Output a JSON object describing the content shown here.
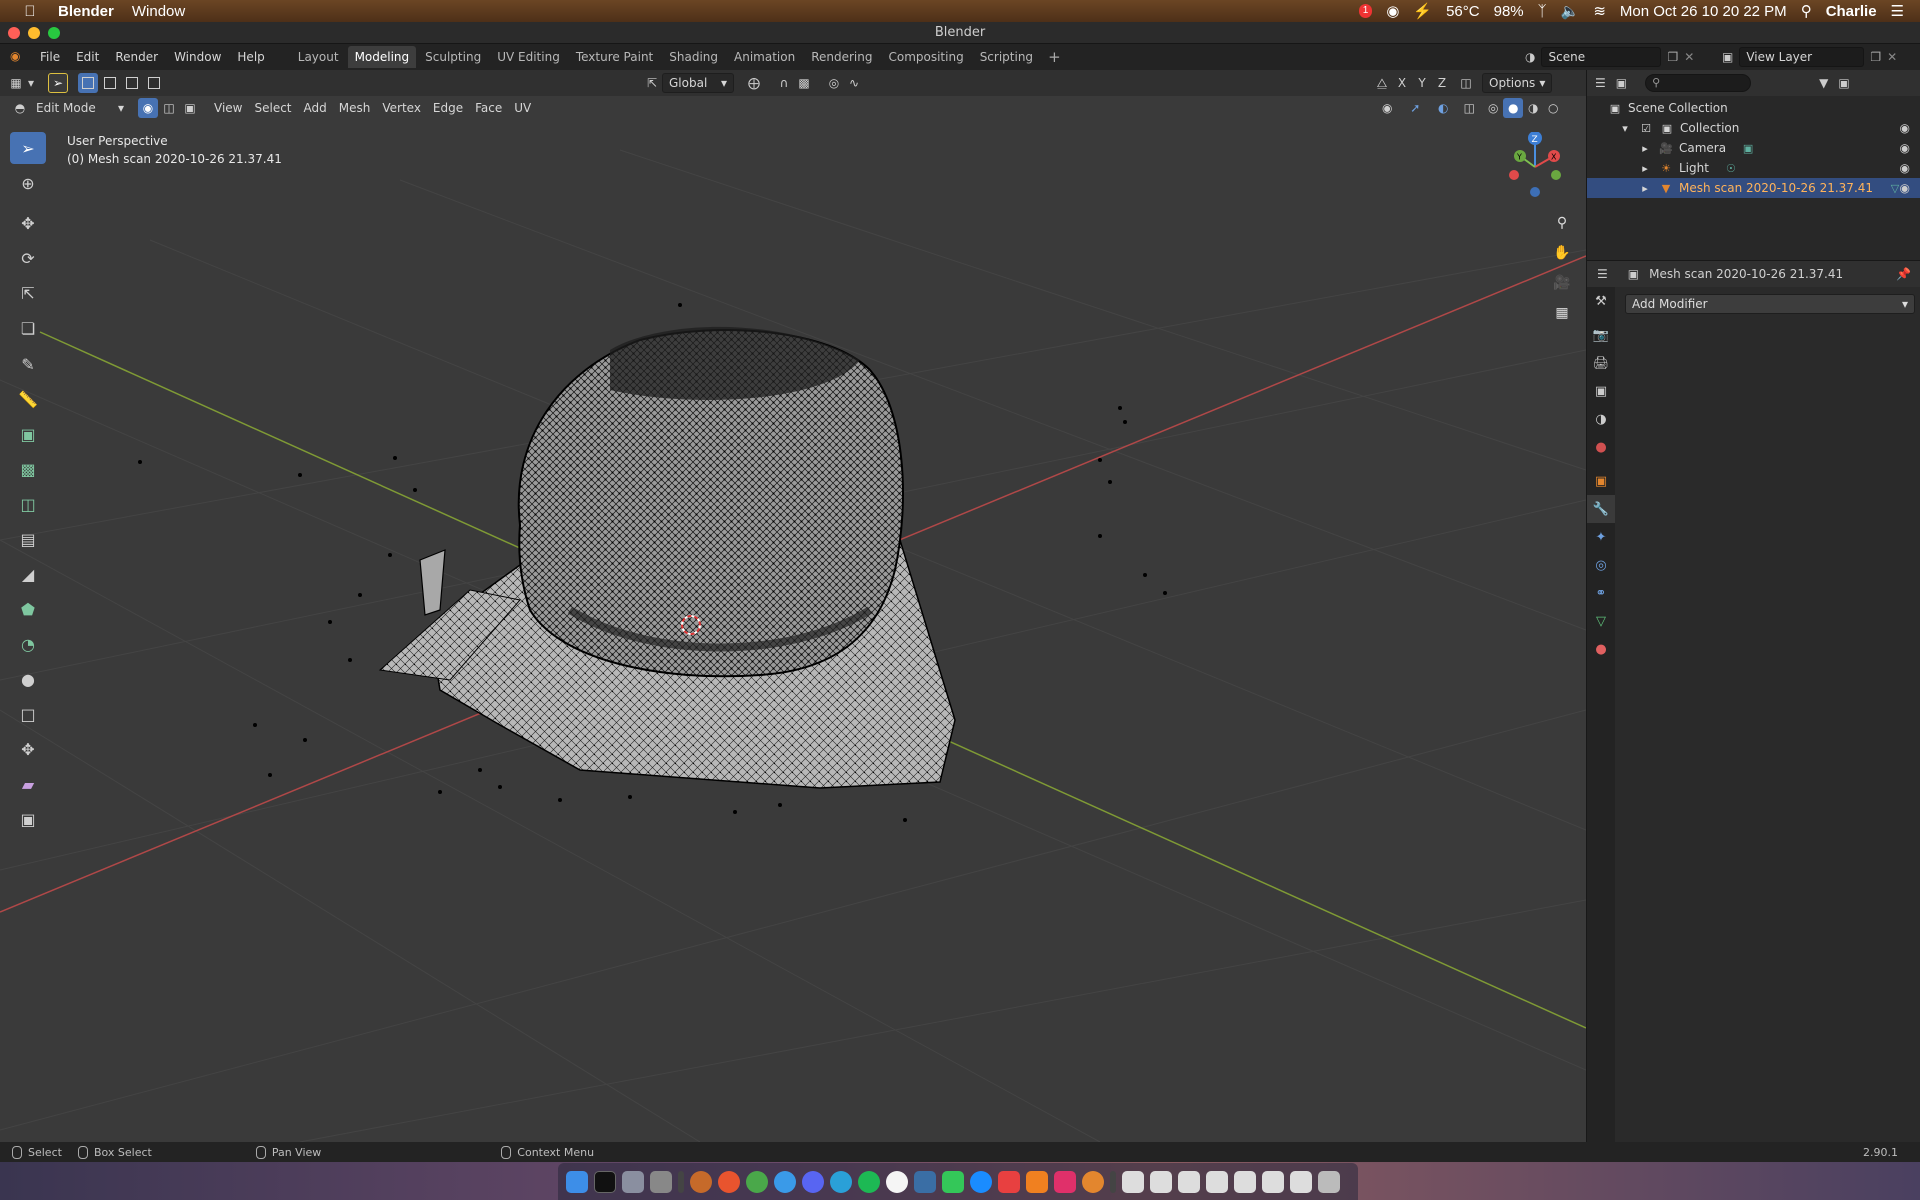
{
  "macos": {
    "app_name": "Blender",
    "menu_window": "Window",
    "notif_count": "1",
    "temp": "56°C",
    "battery": "98%",
    "datetime": "Mon Oct 26  10 20 22 PM",
    "user": "Charlie"
  },
  "window_title": "Blender",
  "menu": {
    "items": [
      "File",
      "Edit",
      "Render",
      "Window",
      "Help"
    ]
  },
  "workspaces": [
    "Layout",
    "Modeling",
    "Sculpting",
    "UV Editing",
    "Texture Paint",
    "Shading",
    "Animation",
    "Rendering",
    "Compositing",
    "Scripting"
  ],
  "active_workspace": "Modeling",
  "scene_name": "Scene",
  "view_layer": "View Layer",
  "viewport": {
    "transform_orientation": "Global",
    "options_label": "Options",
    "axis_x": "X",
    "axis_y": "Y",
    "axis_z": "Z",
    "mode": "Edit Mode",
    "header_menus": [
      "View",
      "Select",
      "Add",
      "Mesh",
      "Vertex",
      "Edge",
      "Face",
      "UV"
    ],
    "info_line1": "User Perspective",
    "info_line2": "(0) Mesh scan 2020-10-26 21.37.41"
  },
  "outliner": {
    "scene_collection": "Scene Collection",
    "collection": "Collection",
    "camera": "Camera",
    "light": "Light",
    "mesh": "Mesh scan 2020-10-26 21.37.41"
  },
  "properties": {
    "object_name": "Mesh scan 2020-10-26 21.37.41",
    "add_modifier": "Add Modifier"
  },
  "statusbar": {
    "select": "Select",
    "box_select": "Box Select",
    "pan_view": "Pan View",
    "context_menu": "Context Menu",
    "version": "2.90.1"
  },
  "colors": {
    "accent_blue": "#4772b3",
    "selected_row": "#334d80",
    "axis_x_red": "#c04a4a",
    "axis_y_green": "#8aa33a",
    "blender_orange": "#e3862e"
  }
}
